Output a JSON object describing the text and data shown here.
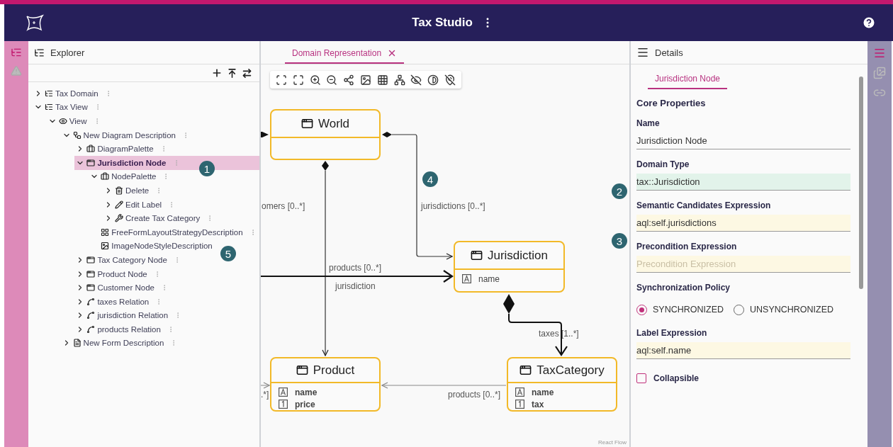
{
  "header": {
    "title": "Tax Studio"
  },
  "explorer": {
    "title": "Explorer",
    "tree": [
      {
        "label": "Tax Domain",
        "kind": "domain",
        "expandable": true,
        "expanded": false,
        "selected": false,
        "more_menu": true
      },
      {
        "label": "Tax View",
        "kind": "domain",
        "expandable": true,
        "expanded": true,
        "selected": false,
        "more_menu": true,
        "children": [
          {
            "label": "View",
            "kind": "view",
            "expandable": true,
            "expanded": true,
            "selected": false,
            "more_menu": true,
            "children": [
              {
                "label": "New Diagram Description",
                "kind": "diagram",
                "expandable": true,
                "expanded": true,
                "selected": false,
                "more_menu": true,
                "children": [
                  {
                    "label": "DiagramPalette",
                    "kind": "palette",
                    "expandable": true,
                    "expanded": false,
                    "selected": false,
                    "more_menu": true
                  },
                  {
                    "label": "Jurisdiction Node",
                    "kind": "node",
                    "expandable": true,
                    "expanded": true,
                    "selected": true,
                    "more_menu": true,
                    "children": [
                      {
                        "label": "NodePalette",
                        "kind": "palette",
                        "expandable": true,
                        "expanded": true,
                        "selected": false,
                        "more_menu": true,
                        "children": [
                          {
                            "label": "Delete",
                            "kind": "delete",
                            "expandable": true,
                            "expanded": false,
                            "selected": false,
                            "more_menu": true
                          },
                          {
                            "label": "Edit Label",
                            "kind": "edit",
                            "expandable": true,
                            "expanded": false,
                            "selected": false,
                            "more_menu": true
                          },
                          {
                            "label": "Create Tax Category",
                            "kind": "tool",
                            "expandable": true,
                            "expanded": false,
                            "selected": false,
                            "more_menu": true
                          }
                        ]
                      },
                      {
                        "label": "FreeFormLayoutStrategyDescription",
                        "kind": "layout",
                        "expandable": false,
                        "selected": false,
                        "more_menu": true
                      },
                      {
                        "label": "ImageNodeStyleDescription",
                        "kind": "style",
                        "expandable": false,
                        "selected": false,
                        "more_menu": false
                      }
                    ]
                  },
                  {
                    "label": "Tax Category Node",
                    "kind": "node",
                    "expandable": true,
                    "expanded": false,
                    "selected": false,
                    "more_menu": true
                  },
                  {
                    "label": "Product Node",
                    "kind": "node",
                    "expandable": true,
                    "expanded": false,
                    "selected": false,
                    "more_menu": true
                  },
                  {
                    "label": "Customer Node",
                    "kind": "node",
                    "expandable": true,
                    "expanded": false,
                    "selected": false,
                    "more_menu": true
                  },
                  {
                    "label": "taxes Relation",
                    "kind": "relation",
                    "expandable": true,
                    "expanded": false,
                    "selected": false,
                    "more_menu": true
                  },
                  {
                    "label": "jurisdiction Relation",
                    "kind": "relation",
                    "expandable": true,
                    "expanded": false,
                    "selected": false,
                    "more_menu": true
                  },
                  {
                    "label": "products Relation",
                    "kind": "relation",
                    "expandable": true,
                    "expanded": false,
                    "selected": false,
                    "more_menu": true
                  }
                ]
              },
              {
                "label": "New Form Description",
                "kind": "form",
                "expandable": true,
                "expanded": false,
                "selected": false,
                "more_menu": true
              }
            ]
          }
        ]
      }
    ]
  },
  "editor": {
    "tabs": [
      {
        "label": "Domain Representation",
        "selected": true
      }
    ],
    "nodes": [
      {
        "title": "World"
      },
      {
        "title": "Jurisdiction",
        "attributes": [
          {
            "kind": "string",
            "name": "name",
            "emphasized": false
          }
        ]
      },
      {
        "title": "Product",
        "attributes": [
          {
            "kind": "string",
            "name": "name",
            "emphasized": true
          },
          {
            "kind": "number",
            "name": "price",
            "emphasized": true
          }
        ]
      },
      {
        "title": "TaxCategory",
        "attributes": [
          {
            "kind": "string",
            "name": "name",
            "emphasized": true
          },
          {
            "kind": "number",
            "name": "tax",
            "emphasized": true
          }
        ]
      }
    ],
    "edge_labels": [
      "omers [0..*]",
      "jurisdictions [0..*]",
      "products [0..*]",
      "jurisdiction",
      "taxes [1..*]",
      ".*]",
      "products [0..*]"
    ],
    "attribution": "React Flow"
  },
  "details": {
    "title": "Details",
    "tabs": [
      {
        "label": "Jurisdiction Node",
        "selected": true
      }
    ],
    "section": "Core Properties",
    "properties": [
      {
        "kind": "text",
        "label": "Name",
        "value": "Jurisdiction Node"
      },
      {
        "kind": "domain",
        "label": "Domain Type",
        "value": "tax::Jurisdiction"
      },
      {
        "kind": "expression",
        "label": "Semantic Candidates Expression",
        "value": "aql:self.jurisdictions"
      },
      {
        "kind": "expression",
        "label": "Precondition Expression",
        "placeholder": "Precondition Expression"
      },
      {
        "kind": "radio",
        "label": "Synchronization Policy",
        "options": [
          {
            "label": "SYNCHRONIZED",
            "selected": true
          },
          {
            "label": "UNSYNCHRONIZED",
            "selected": false
          }
        ]
      },
      {
        "kind": "expression",
        "label": "Label Expression",
        "value": "aql:self.name"
      },
      {
        "kind": "checkbox",
        "label": "Collapsible",
        "checked": false
      }
    ]
  },
  "callouts": [
    "1",
    "2",
    "3",
    "4",
    "5"
  ]
}
